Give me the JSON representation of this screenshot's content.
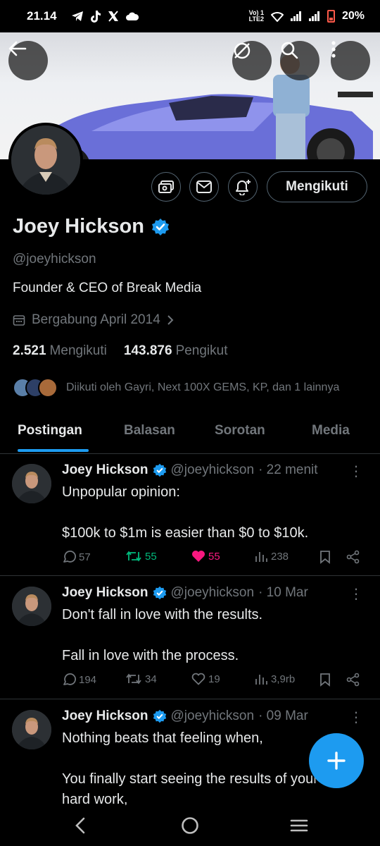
{
  "status_bar": {
    "time": "21.14",
    "carrier_top": "Vo) 1",
    "carrier_bottom": "LTE2",
    "battery": "20%",
    "battery_color": "#ff5a4a"
  },
  "header": {
    "back_icon": "arrow-left-icon",
    "grok_icon": "grok-icon",
    "search_icon": "search-icon",
    "more_icon": "more-vertical-icon"
  },
  "profile": {
    "name": "Joey Hickson",
    "handle": "@joeyhickson",
    "bio": "Founder & CEO of Break Media",
    "joined": "Bergabung April 2014",
    "following_count": "2.521",
    "following_label": "Mengikuti",
    "followers_count": "143.876",
    "followers_label": "Pengikut",
    "followed_by": "Diikuti oleh Gayri, Next 100X GEMS, KP, dan 1 lainnya",
    "follow_button": "Mengikuti",
    "verified_color": "#1d9bf0"
  },
  "tabs": [
    {
      "label": "Postingan",
      "active": true
    },
    {
      "label": "Balasan",
      "active": false
    },
    {
      "label": "Sorotan",
      "active": false
    },
    {
      "label": "Media",
      "active": false
    }
  ],
  "tweets": [
    {
      "name": "Joey Hickson",
      "handle": "@joeyhickson",
      "time": "· 22 menit",
      "line1": "Unpopular opinion:",
      "line2": "$100k to $1m is easier than $0 to $10k.",
      "replies": "57",
      "retweets": "55",
      "likes": "55",
      "views": "238",
      "retweeted": true,
      "liked": true
    },
    {
      "name": "Joey Hickson",
      "handle": "@joeyhickson",
      "time": "· 10 Mar",
      "line1": "Don't fall in love with the results.",
      "line2": "Fall in love with the process.",
      "replies": "194",
      "retweets": "34",
      "likes": "19",
      "views": "3,9rb",
      "retweeted": false,
      "liked": false
    },
    {
      "name": "Joey Hickson",
      "handle": "@joeyhickson",
      "time": "· 09 Mar",
      "line1": "Nothing beats that feeling when,",
      "line2": "You finally start seeing the results of your",
      "line3": "hard work,"
    }
  ],
  "colors": {
    "accent": "#1d9bf0",
    "retweet_green": "#00ba7c",
    "like_pink": "#f91880",
    "muted": "#71767b"
  }
}
